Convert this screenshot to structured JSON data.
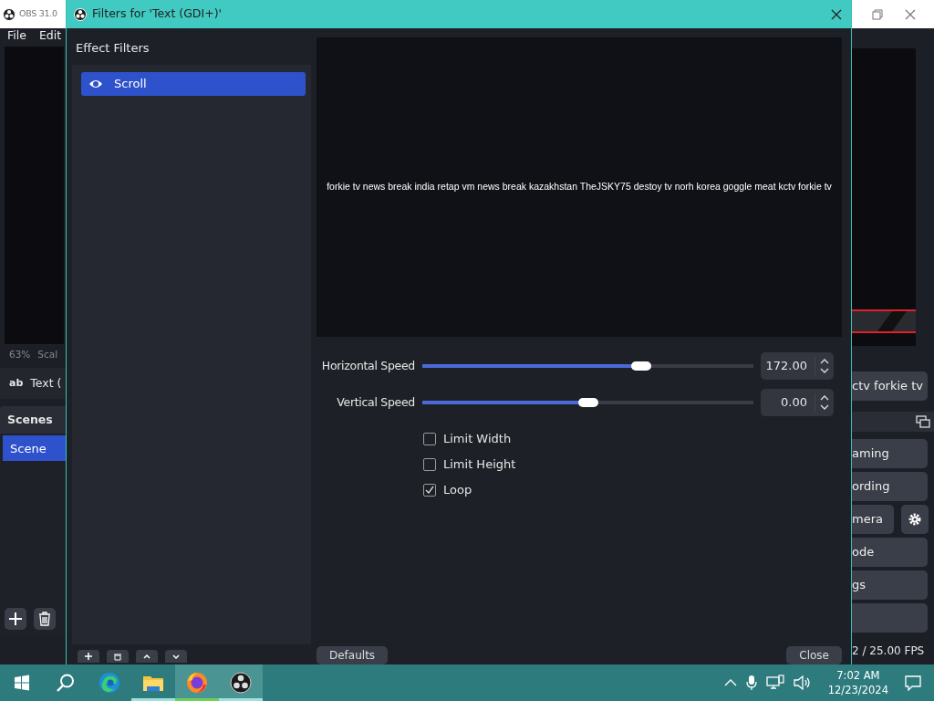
{
  "main_window": {
    "title": "OBS 31.0",
    "menu": [
      "File",
      "Edit"
    ],
    "zoom": "63%",
    "scale_label": "Scal",
    "source": {
      "icon_text": "ab",
      "label": "Text ("
    },
    "scenes": {
      "title": "Scenes",
      "items": [
        {
          "label": "Scene",
          "selected": true
        }
      ]
    },
    "ticker": "ctv forkie tv",
    "controls": [
      {
        "kind": "text",
        "label": "aming"
      },
      {
        "kind": "text",
        "label": "ording"
      },
      {
        "kind": "gear",
        "label": "mera"
      },
      {
        "kind": "text",
        "label": "ode"
      },
      {
        "kind": "text",
        "label": "gs"
      },
      {
        "kind": "blank"
      }
    ],
    "fps": "2 / 25.00 FPS"
  },
  "dialog": {
    "title": "Filters for 'Text (GDI+)'",
    "filters_heading": "Effect Filters",
    "filters": [
      {
        "label": "Scroll",
        "selected": true
      }
    ],
    "preview_text": "forkie tv news break india retap vm news break kazakhstan TheJSKY75 destoy tv norh korea goggle meat kctv forkie tv",
    "sliders": [
      {
        "label": "Horizontal Speed",
        "level": 0.66,
        "value": "172.00"
      },
      {
        "label": "Vertical Speed",
        "level": 0.5,
        "value": "0.00"
      }
    ],
    "checkboxes": [
      {
        "label": "Limit Width",
        "checked": false
      },
      {
        "label": "Limit Height",
        "checked": false
      },
      {
        "label": "Loop",
        "checked": true
      }
    ],
    "buttons": [
      "Defaults",
      "Close"
    ]
  },
  "taskbar": {
    "apps": [
      {
        "kind": "edge",
        "running": false,
        "selected": false
      },
      {
        "kind": "explorer",
        "running": true,
        "selected": false
      },
      {
        "kind": "firefox",
        "running": true,
        "selected": true
      },
      {
        "kind": "obs",
        "running": true,
        "selected": true
      }
    ],
    "time": "7:02 AM",
    "date": "12/23/2024"
  }
}
